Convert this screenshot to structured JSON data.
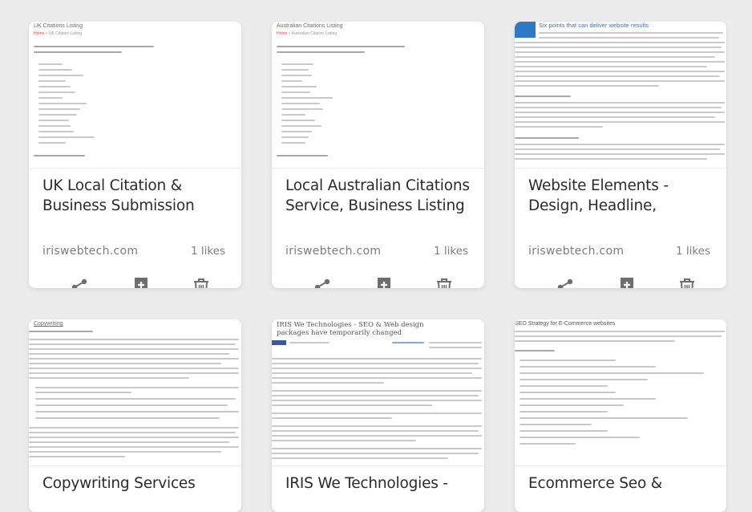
{
  "cards": [
    {
      "thumb_title": "UK Citations Listing",
      "thumb_crumb_home": "Home",
      "thumb_crumb_rest": "» UK Citation Listing",
      "title": "UK Local Citation & Business Submission",
      "domain": "iriswebtech.com",
      "likes": "1 likes",
      "share_icon": "share-icon",
      "bookmark_icon": "bookmark-add-icon",
      "delete_icon": "trash-icon"
    },
    {
      "thumb_title": "Australian Citations Listing",
      "thumb_crumb_home": "Home",
      "thumb_crumb_rest": "» Australian Citation Listing",
      "title": "Local Australian Citations Service, Business Listing",
      "domain": "iriswebtech.com",
      "likes": "1 likes",
      "share_icon": "share-icon",
      "bookmark_icon": "bookmark-add-icon",
      "delete_icon": "trash-icon"
    },
    {
      "thumb_title": "Six points that can deliver website results",
      "title": "Website Elements - Design, Headline,",
      "domain": "iriswebtech.com",
      "likes": "1 likes",
      "share_icon": "share-icon",
      "bookmark_icon": "bookmark-add-icon",
      "delete_icon": "trash-icon"
    },
    {
      "thumb_title": "Copywriting",
      "title": "Copywriting Services"
    },
    {
      "thumb_title": "IRIS We Technologies - SEO & Web design packages have temporarily changed",
      "title": "IRIS We Technologies -"
    },
    {
      "thumb_title": "SEO Strategy for E-Commerce websites",
      "title": "Ecommerce Seo &"
    }
  ],
  "colors": {
    "background": "#ececec",
    "card": "#ffffff",
    "icon": "#6e6e6e",
    "text": "#2b2b2b",
    "muted": "#7c7c7c"
  }
}
